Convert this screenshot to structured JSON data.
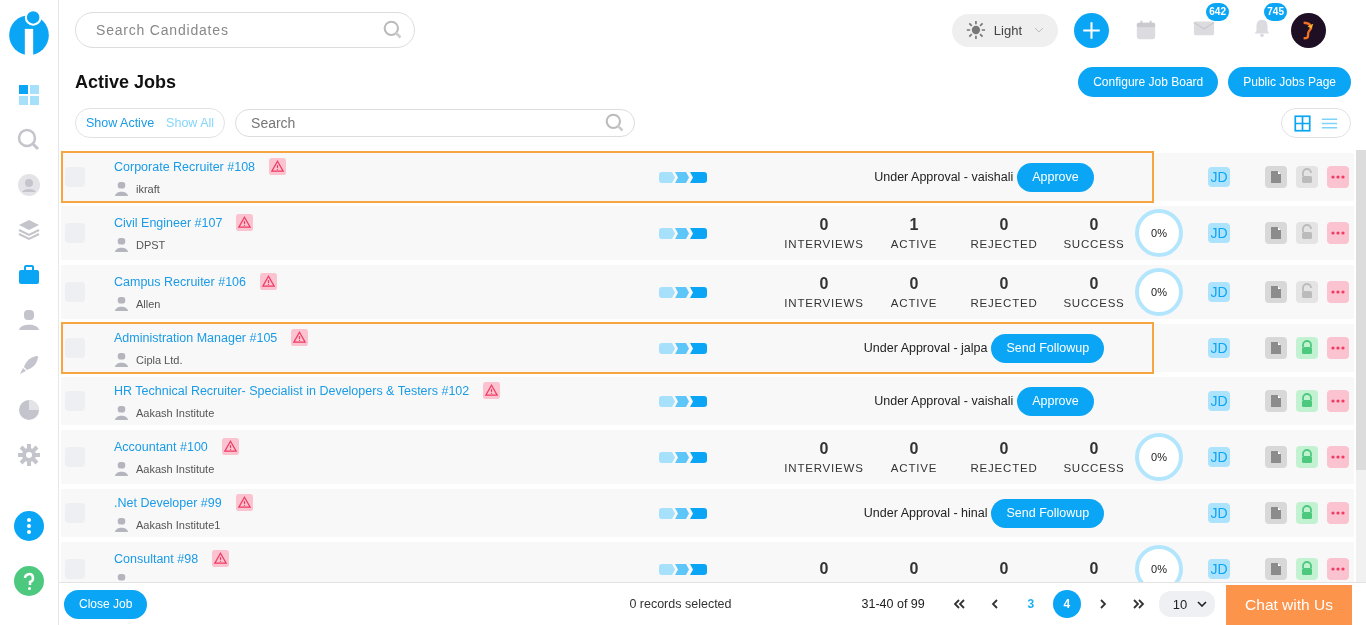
{
  "header": {
    "search": {
      "placeholder": "Search Candidates"
    },
    "theme": {
      "label": "Light"
    },
    "mail_badge": "642",
    "bell_badge": "745"
  },
  "sidebar": {
    "items": [
      {
        "kind": "dashboard",
        "selected": false
      },
      {
        "kind": "search",
        "selected": false
      },
      {
        "kind": "profile",
        "selected": false
      },
      {
        "kind": "layers",
        "selected": false
      },
      {
        "kind": "briefcase",
        "selected": true
      },
      {
        "kind": "user",
        "selected": false
      },
      {
        "kind": "rocket",
        "selected": false
      },
      {
        "kind": "pie",
        "selected": false
      },
      {
        "kind": "gear",
        "selected": false
      }
    ]
  },
  "page": {
    "title": "Active Jobs",
    "buttons": [
      "Configure Job Board",
      "Public Jobs Page"
    ]
  },
  "filters": {
    "toggles": [
      {
        "label": "Show Active",
        "selected": true
      },
      {
        "label": "Show All",
        "selected": false
      }
    ],
    "search": {
      "placeholder": "Search"
    },
    "view_modes": [
      {
        "kind": "grid",
        "selected": true
      },
      {
        "kind": "list",
        "selected": false
      }
    ]
  },
  "jobs": [
    {
      "title": "Corporate Recruiter #108",
      "checked": false,
      "company": "ikraft",
      "kind": "approval",
      "status": "Under Approval - vaishali",
      "action": "Approve",
      "highlighted": true,
      "badge": "JD",
      "locked": false
    },
    {
      "title": "Civil Engineer #107",
      "checked": false,
      "company": "DPST",
      "kind": "stats",
      "stats": [
        {
          "value": "0",
          "label": "INTERVIEWS"
        },
        {
          "value": "1",
          "label": "ACTIVE"
        },
        {
          "value": "0",
          "label": "REJECTED"
        },
        {
          "value": "0",
          "label": "SUCCESS"
        }
      ],
      "progress": "0%",
      "highlighted": false,
      "badge": "JD",
      "locked": false
    },
    {
      "title": "Campus Recruiter #106",
      "checked": false,
      "company": "Allen",
      "kind": "stats",
      "stats": [
        {
          "value": "0",
          "label": "INTERVIEWS"
        },
        {
          "value": "0",
          "label": "ACTIVE"
        },
        {
          "value": "0",
          "label": "REJECTED"
        },
        {
          "value": "0",
          "label": "SUCCESS"
        }
      ],
      "progress": "0%",
      "highlighted": false,
      "badge": "JD",
      "locked": false
    },
    {
      "title": "Administration Manager #105",
      "checked": false,
      "company": "Cipla Ltd.",
      "kind": "approval",
      "status": "Under Approval - jalpa",
      "action": "Send Followup",
      "highlighted": true,
      "badge": "JD",
      "locked": true
    },
    {
      "title": "HR Technical Recruiter- Specialist in Developers & Testers #102",
      "checked": false,
      "company": "Aakash Institute",
      "kind": "approval",
      "status": "Under Approval - vaishali",
      "action": "Approve",
      "highlighted": false,
      "badge": "JD",
      "locked": true
    },
    {
      "title": "Accountant #100",
      "checked": false,
      "company": "Aakash Institute",
      "kind": "stats",
      "stats": [
        {
          "value": "0",
          "label": "INTERVIEWS"
        },
        {
          "value": "0",
          "label": "ACTIVE"
        },
        {
          "value": "0",
          "label": "REJECTED"
        },
        {
          "value": "0",
          "label": "SUCCESS"
        }
      ],
      "progress": "0%",
      "highlighted": false,
      "badge": "JD",
      "locked": true
    },
    {
      "title": ".Net Developer #99",
      "checked": false,
      "company": "Aakash Institute1",
      "kind": "approval",
      "status": "Under Approval - hinal",
      "action": "Send Followup",
      "highlighted": false,
      "badge": "JD",
      "locked": true
    },
    {
      "title": "Consultant #98",
      "checked": false,
      "kind": "stats",
      "stats": [
        {
          "value": "0"
        },
        {
          "value": "0"
        },
        {
          "value": "0"
        },
        {
          "value": "0"
        }
      ],
      "progress": "0%",
      "highlighted": false,
      "badge": "JD",
      "locked": true
    }
  ],
  "footer": {
    "close_button": "Close Job",
    "selection": "0 records selected",
    "range": "31-40 of 99",
    "pages": [
      {
        "label": "3",
        "selected": false
      },
      {
        "label": "4",
        "selected": true
      }
    ],
    "page_size": "10",
    "chat": "Chat with Us"
  }
}
